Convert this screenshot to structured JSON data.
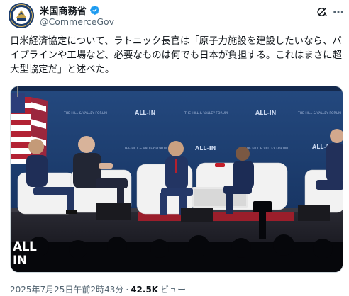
{
  "author": {
    "display_name": "米国商務省",
    "handle": "@CommerceGov",
    "avatar_icon": "department-of-commerce-seal-icon",
    "verified_icon": "verified-badge-icon",
    "verified_color": "#1d9bf0"
  },
  "post": {
    "text": "日米経済協定について、ラトニック長官は「原子力施設を建設したいなら、パイプラインや工場など、必要なものは何でも日本が負担する。これはまさに超大型協定だ」と述べた。"
  },
  "media": {
    "type": "video",
    "watermark_line1": "ALL",
    "watermark_line2": "IN",
    "backdrop_banner_large": "ALL-IN",
    "backdrop_banner_small": "THE HILL & VALLEY FORUM"
  },
  "meta": {
    "timestamp": "2025年7月25日午前2時43分",
    "separator": "·",
    "views_count": "42.5K",
    "views_label": "ビュー"
  },
  "header_icons": {
    "grok": "grok-icon",
    "more": "more-options-icon"
  },
  "colors": {
    "text_primary": "#0f1419",
    "text_secondary": "#536471",
    "accent": "#1d9bf0",
    "stage_blue": "#1e3f74"
  }
}
